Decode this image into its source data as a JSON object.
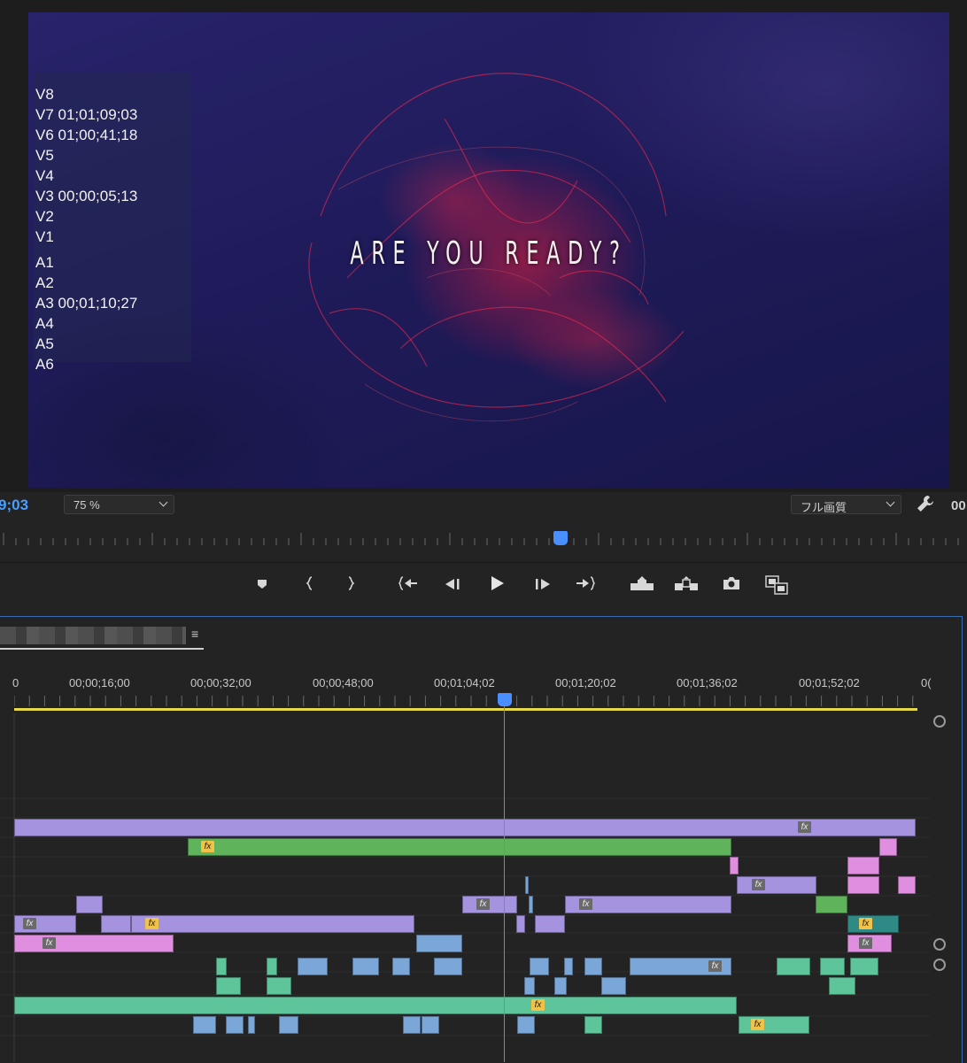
{
  "monitor": {
    "overlay_lines": [
      "V8",
      "V7 01;01;09;03",
      "V6 01;00;41;18",
      "V5",
      "V4",
      "V3 00;00;05;13",
      "V2",
      "V1",
      "A1",
      "A2",
      "A3 00;01;10;27",
      "A4",
      "A5",
      "A6"
    ],
    "headline": "ARE YOU READY?",
    "timecode": "9;03",
    "zoom": "75 %",
    "quality": "フル画質",
    "timecode_right": "00"
  },
  "transport": {
    "buttons": [
      "marker-icon",
      "mark-in-icon",
      "mark-out-icon",
      "go-to-in-icon",
      "step-back-icon",
      "play-icon",
      "step-forward-icon",
      "go-to-out-icon",
      "lift-icon",
      "extract-icon",
      "export-frame-icon",
      "compare-icon"
    ]
  },
  "timeline": {
    "menu_glyph": "≡",
    "ruler_labels": [
      "0",
      "00;00;16;00",
      "00;00;32;00",
      "00;00;48;00",
      "00;01;04;02",
      "00;01;20;02",
      "00;01;36;02",
      "00;01;52;02",
      "0("
    ],
    "colors": {
      "purple": "#a593e0",
      "green": "#5fb35a",
      "pink": "#e08ee0",
      "blue": "#7aa6d8",
      "audio_green": "#5ec49a",
      "teal": "#2f8a86",
      "playhead": "#4a8fff",
      "work_area": "#e4d94a"
    }
  }
}
